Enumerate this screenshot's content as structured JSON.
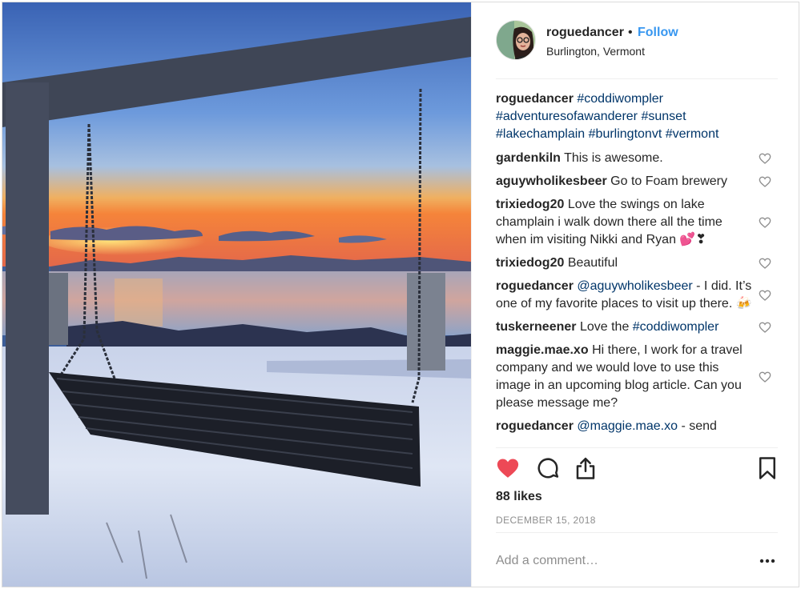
{
  "header": {
    "username": "roguedancer",
    "separator": "•",
    "follow_label": "Follow",
    "location": "Burlington, Vermont"
  },
  "caption": {
    "username": "roguedancer",
    "tags": [
      "#coddiwompler",
      "#adventuresofawanderer",
      "#sunset",
      "#lakechamplain",
      "#burlingtonvt",
      "#vermont"
    ]
  },
  "comments": [
    {
      "username": "gardenkiln",
      "text": "This is awesome."
    },
    {
      "username": "aguywholikesbeer",
      "text": "Go to Foam brewery"
    },
    {
      "username": "trixiedog20",
      "text": "Love the swings on lake champlain i walk down there all the time when im visiting Nikki and Ryan 💕❣"
    },
    {
      "username": "trixiedog20",
      "text": "Beautiful"
    },
    {
      "username": "roguedancer",
      "mention": "@aguywholikesbeer",
      "text": " - I did. It’s one of my favorite places to visit up there. 🍻"
    },
    {
      "username": "tuskerneener",
      "text": "Love the ",
      "hashtag": "#coddiwompler"
    },
    {
      "username": "maggie.mae.xo",
      "text": "Hi there, I work for a travel company and we would love to use this image in an upcoming blog article. Can you please message me?"
    },
    {
      "username": "roguedancer",
      "mention": "@maggie.mae.xo",
      "text": " - send"
    }
  ],
  "actions": {
    "like_icon": "heart-filled-icon",
    "comment_icon": "comment-bubble-icon",
    "share_icon": "share-icon",
    "save_icon": "bookmark-icon"
  },
  "likes_text": "88 likes",
  "date_text": "DECEMBER 15, 2018",
  "add_comment": {
    "placeholder": "Add a comment…"
  },
  "more_icon": "more-dots-icon",
  "colors": {
    "like": "#ed4956",
    "follow": "#3897f0",
    "hashtag": "#003569",
    "muted": "#8e8e8e"
  }
}
